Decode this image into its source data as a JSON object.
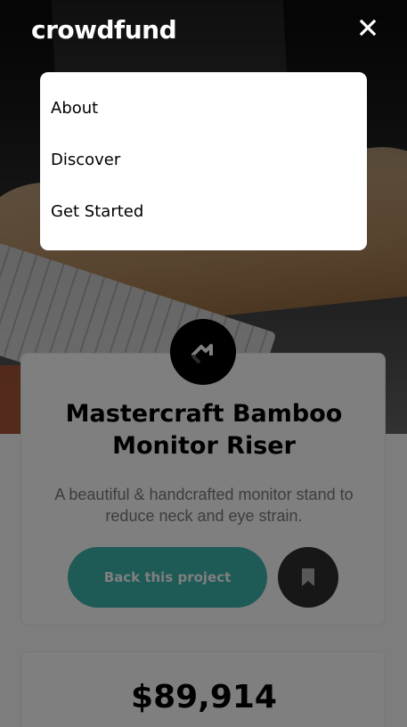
{
  "header": {
    "logo": "crowdfund",
    "close_icon": "close-icon"
  },
  "menu": {
    "items": [
      {
        "label": "About"
      },
      {
        "label": "Discover"
      },
      {
        "label": "Get Started"
      }
    ]
  },
  "project": {
    "logo_icon": "mastercraft-logo-icon",
    "title": "Mastercraft Bamboo Monitor Riser",
    "description": "A beautiful & handcrafted monitor stand to reduce neck and eye strain.",
    "back_label": "Back this project",
    "bookmark_icon": "bookmark-icon"
  },
  "stats": {
    "amount_backed": "$89,914"
  },
  "colors": {
    "accent": "#3cb4ac",
    "dark": "#2f2f2f",
    "overlay": "rgba(0,0,0,0.5)"
  }
}
